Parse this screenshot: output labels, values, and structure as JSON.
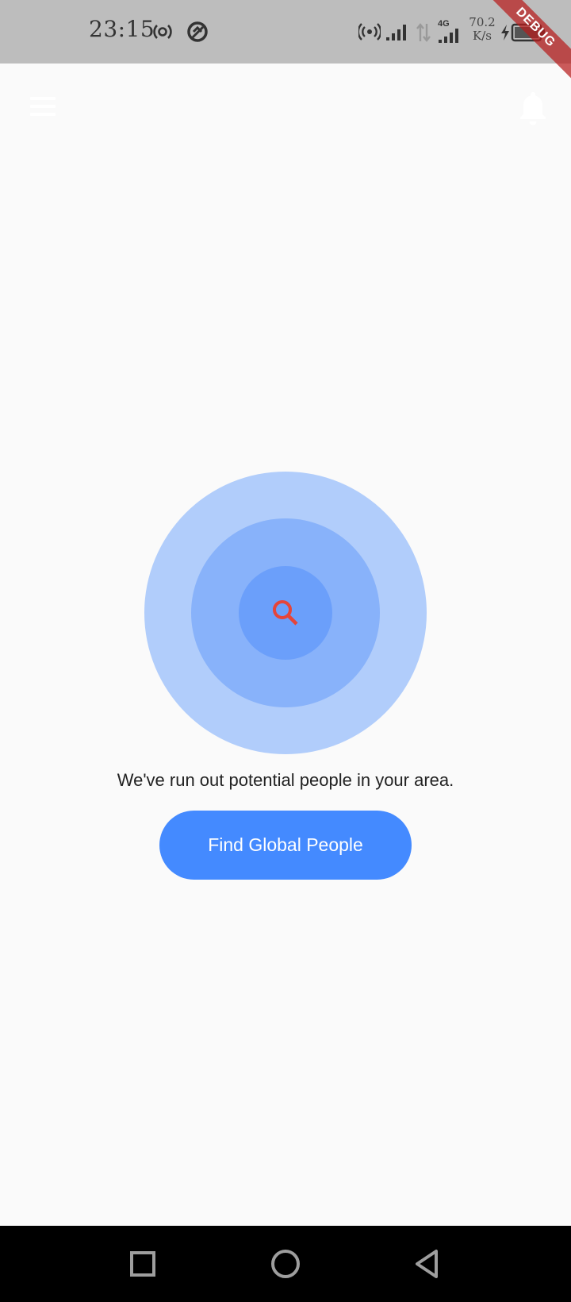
{
  "status_bar": {
    "time": "23:15",
    "network_type": "4G",
    "speed_value": "70.2",
    "speed_unit": "K/s",
    "icons": [
      "hotspot-icon",
      "data-saver-icon",
      "wireless-icon",
      "signal-icon",
      "data-transfer-icon",
      "signal-4g-icon",
      "charging-icon",
      "battery-icon"
    ]
  },
  "debug_banner": "DEBUG",
  "app_bar": {
    "left_icon": "menu-icon",
    "right_icon": "bell-icon",
    "icon_color": "#ffffff"
  },
  "radar": {
    "icon": "search-icon",
    "icon_color": "#e5453a",
    "colors": {
      "outer": "#b1cdfb",
      "middle": "#88b2fa",
      "inner": "#6b9ffa"
    }
  },
  "main": {
    "message": "We've run out potential people in your area.",
    "button_label": "Find Global People",
    "button_color": "#448aff"
  },
  "nav_bar": {
    "buttons": [
      "recents-square-icon",
      "home-circle-icon",
      "back-triangle-icon"
    ]
  }
}
